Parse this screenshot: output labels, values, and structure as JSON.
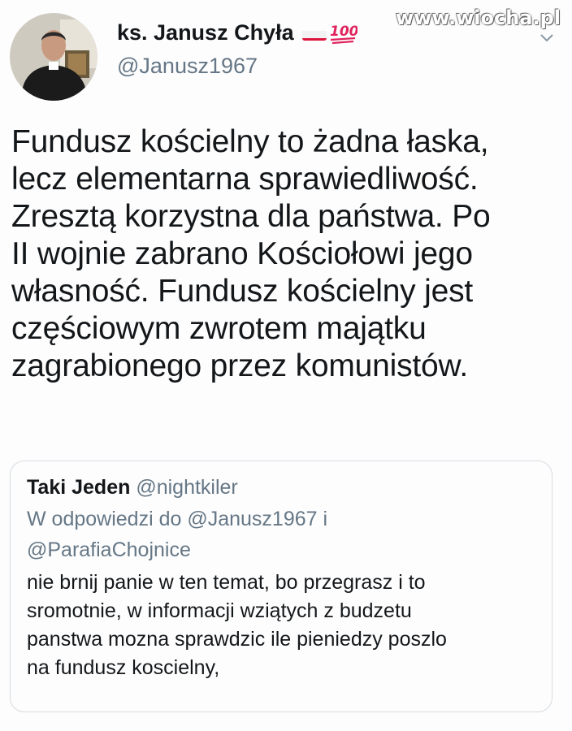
{
  "watermark": "www.wiocha.pl",
  "author": {
    "display_name": "ks. Janusz Chyła",
    "handle": "@Janusz1967",
    "emoji_flag": "poland-flag",
    "emoji_badge": "100-icon"
  },
  "tweet": {
    "text": "Fundusz kościelny to żadna łaska,\nlecz elementarna sprawiedliwość.\nZresztą korzystna dla państwa. Po\nII wojnie zabrano Kościołowi jego\nwłasność. Fundusz kościelny jest\nczęściowym zwrotem majątku\nzagrabionego przez komunistów."
  },
  "quoted": {
    "name": "Taki Jeden",
    "handle": "@nightkiler",
    "reply_line1": "W odpowiedzi do @Janusz1967 i",
    "reply_line2": "@ParafiaChojnice",
    "text": "nie brnij panie w ten temat, bo przegrasz i to\nsromotnie, w informacji wziątych z budzetu\npanstwa mozna sprawdzic ile pieniedzy poszlo\nna fundusz koscielny,"
  },
  "colors": {
    "text": "#14171a",
    "secondary": "#657786",
    "border": "#d6dbe0",
    "flag_red": "#dc143c"
  }
}
